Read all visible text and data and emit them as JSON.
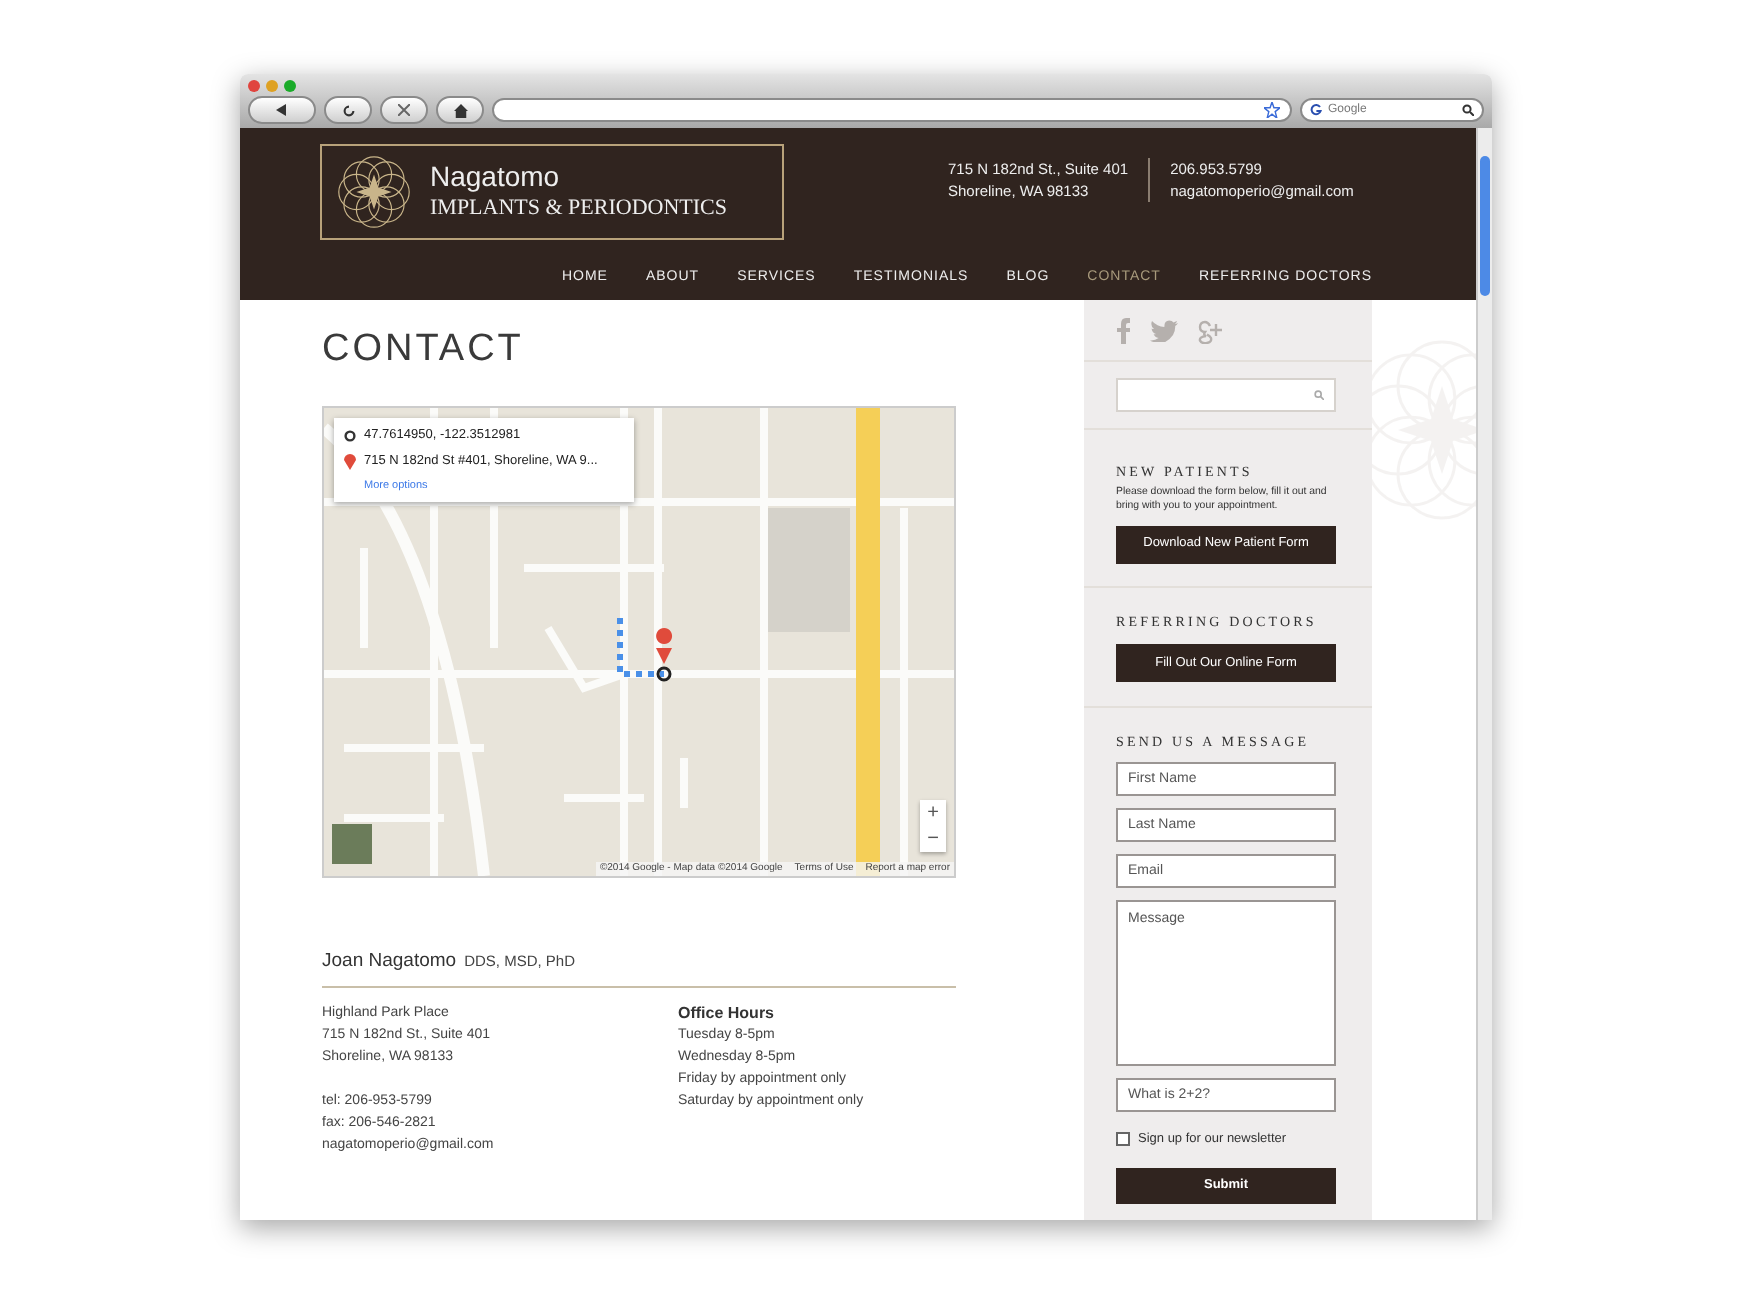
{
  "browser": {
    "search_placeholder": "Google"
  },
  "header": {
    "logo_name": "Nagatomo",
    "logo_subtitle": "IMPLANTS & PERIODONTICS",
    "address_lines": [
      "715 N 182nd St., Suite 401",
      "Shoreline, WA 98133"
    ],
    "contact_lines": [
      "206.953.5799",
      "nagatomoperio@gmail.com"
    ]
  },
  "nav": [
    {
      "label": "HOME",
      "selected": false
    },
    {
      "label": "ABOUT",
      "selected": false
    },
    {
      "label": "SERVICES",
      "selected": false
    },
    {
      "label": "TESTIMONIALS",
      "selected": false
    },
    {
      "label": "BLOG",
      "selected": false
    },
    {
      "label": "CONTACT",
      "selected": true
    },
    {
      "label": "REFERRING DOCTORS",
      "selected": false
    }
  ],
  "page_title": "CONTACT",
  "map": {
    "info_card": {
      "coordinates": "47.7614950, -122.3512981",
      "address": "715 N 182nd St #401, Shoreline, WA 9...",
      "link": "More options"
    },
    "zoom_buttons": [
      "+",
      "−"
    ],
    "attribution": [
      "©2014 Google - Map data ©2014 Google",
      "Terms of Use",
      "Report a map error"
    ]
  },
  "doctor": {
    "name": "Joan Nagatomo",
    "credentials": "DDS, MSD, PhD"
  },
  "address_lines": [
    "Highland Park Place",
    "715 N 182nd St., Suite 401",
    "Shoreline, WA 98133"
  ],
  "contact_lines": [
    "tel: 206-953-5799",
    "fax: 206-546-2821",
    "nagatomoperio@gmail.com"
  ],
  "office_hours": {
    "title": "Office Hours",
    "lines": [
      "Tuesday 8-5pm",
      "Wednesday 8-5pm",
      "Friday by appointment only",
      "Saturday by appointment only"
    ]
  },
  "sidebar": {
    "new_patients": {
      "heading": "NEW PATIENTS",
      "text": "Please download the form below, fill it out and bring with you to your appointment.",
      "button": "Download New Patient Form"
    },
    "referring": {
      "heading": "REFERRING DOCTORS",
      "button": "Fill Out Our Online Form"
    },
    "message_form": {
      "heading": "SEND US A MESSAGE",
      "fields": [
        {
          "kind": "input",
          "placeholder": "First Name"
        },
        {
          "kind": "input",
          "placeholder": "Last Name"
        },
        {
          "kind": "input",
          "placeholder": "Email"
        },
        {
          "kind": "textarea",
          "placeholder": "Message"
        },
        {
          "kind": "input",
          "placeholder": "What is 2+2?"
        }
      ],
      "newsletter": {
        "label": "Sign up for our newsletter",
        "checked": false
      },
      "submit": "Submit"
    }
  }
}
